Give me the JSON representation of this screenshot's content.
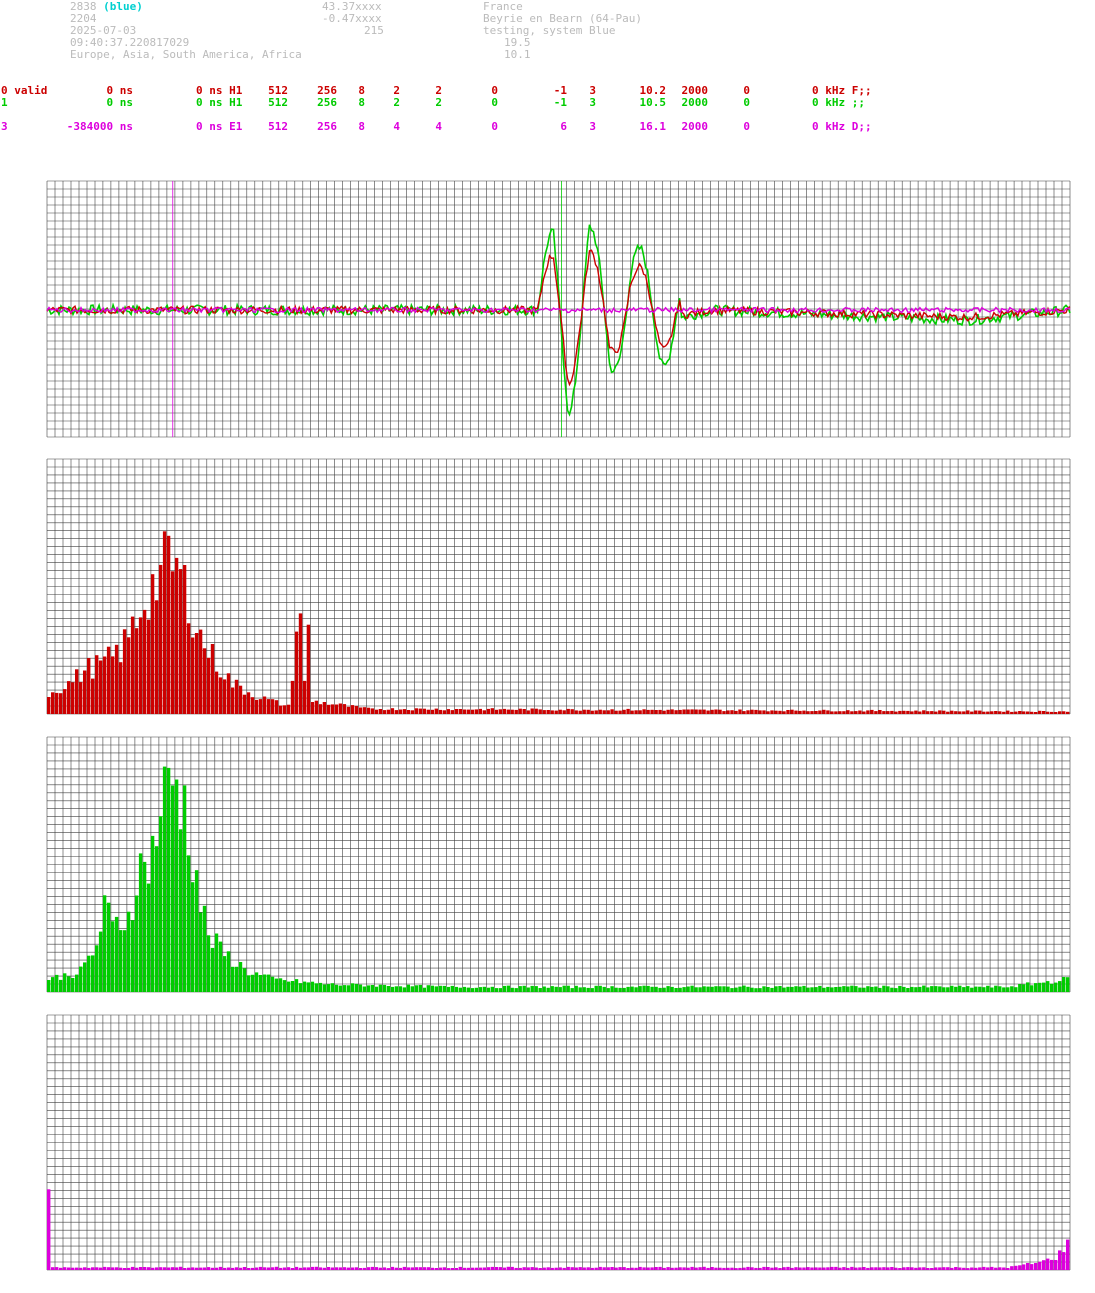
{
  "header": {
    "station_id": "2838",
    "station_tag": "(blue)",
    "station_num": "2204",
    "date": "2025-07-03",
    "time": "09:40:37.220817029",
    "regions": "Europe, Asia, South America, Africa",
    "lat": "43.37xxxx",
    "lon": "-0.47xxxx",
    "alt": "215",
    "country": "France",
    "place": "Beyrie en Bearn (64-Pau)",
    "status": "testing, system Blue",
    "val1": "19.5",
    "val2": "10.1"
  },
  "channels": [
    {
      "c0": "0 valid",
      "c1": "0 ns",
      "c2": "0 ns H1",
      "c3": "512",
      "c4": "256",
      "c5": "8",
      "c6": "2",
      "c7": "2",
      "c8": "0",
      "c9": "-1",
      "c10": "3",
      "c11": "10.2",
      "c12": "2000",
      "c13": "0",
      "c14": "0 kHz F;;"
    },
    {
      "c0": "1",
      "c1": "0 ns",
      "c2": "0 ns H1",
      "c3": "512",
      "c4": "256",
      "c5": "8",
      "c6": "2",
      "c7": "2",
      "c8": "0",
      "c9": "-1",
      "c10": "3",
      "c11": "10.5",
      "c12": "2000",
      "c13": "0",
      "c14": "0 kHz ;;"
    },
    {
      "c0": "3",
      "c1": "-384000 ns",
      "c2": "0 ns E1",
      "c3": "512",
      "c4": "256",
      "c5": "8",
      "c6": "4",
      "c7": "4",
      "c8": "0",
      "c9": "6",
      "c10": "3",
      "c11": "16.1",
      "c12": "2000",
      "c13": "0",
      "c14": "0 kHz D;;"
    }
  ],
  "colors": {
    "red": "#cc0000",
    "green": "#00cc00",
    "magenta": "#dd00dd",
    "grid": "#000000"
  },
  "chart_data": [
    {
      "type": "line",
      "series": [
        {
          "color": "#cc0000"
        },
        {
          "color": "#00cc00"
        },
        {
          "color": "#dd00dd"
        }
      ],
      "y_range": [
        -1,
        1
      ],
      "key_points": [
        [
          0,
          0
        ],
        [
          0.48,
          0
        ],
        [
          0.495,
          0.3
        ],
        [
          0.51,
          -0.55
        ],
        [
          0.53,
          0.42
        ],
        [
          0.55,
          -0.3
        ],
        [
          0.57,
          0.25
        ],
        [
          0.6,
          -0.1
        ],
        [
          0.65,
          0
        ],
        [
          0.9,
          -0.08
        ],
        [
          1,
          0
        ]
      ],
      "markers_x": [
        0.12,
        0.5
      ],
      "grid": true
    },
    {
      "type": "bar",
      "color": "#cc0000",
      "bins": 256,
      "peak_bins": [
        [
          0,
          0.08
        ],
        [
          5,
          0.12
        ],
        [
          10,
          0.18
        ],
        [
          14,
          0.2
        ],
        [
          18,
          0.25
        ],
        [
          20,
          0.3
        ],
        [
          24,
          0.45
        ],
        [
          26,
          0.5
        ],
        [
          28,
          0.55
        ],
        [
          30,
          0.6
        ],
        [
          32,
          0.57
        ],
        [
          34,
          0.5
        ],
        [
          36,
          0.4
        ],
        [
          38,
          0.3
        ],
        [
          42,
          0.2
        ],
        [
          46,
          0.12
        ],
        [
          52,
          0.07
        ],
        [
          60,
          0.03
        ],
        [
          64,
          0.58
        ],
        [
          66,
          0.05
        ],
        [
          80,
          0.02
        ],
        [
          255,
          0.01
        ]
      ],
      "grid": true
    },
    {
      "type": "bar",
      "color": "#00cc00",
      "bins": 256,
      "peak_bins": [
        [
          0,
          0.05
        ],
        [
          8,
          0.08
        ],
        [
          12,
          0.18
        ],
        [
          14,
          0.33
        ],
        [
          16,
          0.25
        ],
        [
          20,
          0.3
        ],
        [
          22,
          0.45
        ],
        [
          26,
          0.55
        ],
        [
          28,
          0.72
        ],
        [
          30,
          0.8
        ],
        [
          32,
          0.83
        ],
        [
          34,
          0.72
        ],
        [
          36,
          0.55
        ],
        [
          38,
          0.35
        ],
        [
          40,
          0.22
        ],
        [
          44,
          0.15
        ],
        [
          50,
          0.08
        ],
        [
          56,
          0.05
        ],
        [
          70,
          0.03
        ],
        [
          100,
          0.02
        ],
        [
          240,
          0.02
        ],
        [
          255,
          0.05
        ]
      ],
      "grid": true
    },
    {
      "type": "bar",
      "color": "#dd00dd",
      "bins": 256,
      "peak_bins": [
        [
          0,
          0.4
        ],
        [
          1,
          0.01
        ],
        [
          240,
          0.01
        ],
        [
          248,
          0.03
        ],
        [
          252,
          0.05
        ],
        [
          255,
          0.1
        ]
      ],
      "grid": true
    }
  ]
}
